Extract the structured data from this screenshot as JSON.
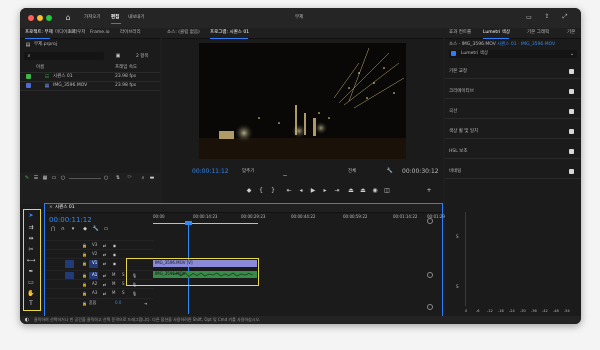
{
  "window": {
    "title": "무제"
  },
  "nav": {
    "home_label": "⌂",
    "import": "가져오기",
    "edit": "편집",
    "export": "내보내기"
  },
  "project_panel": {
    "tabs": [
      "프로젝트: 무제",
      "미디어 브라우저",
      "효과",
      "Frame.io",
      "라이브러리"
    ],
    "path": "무제.prproj",
    "item_count": "2 항목",
    "col_name": "이름",
    "col_fps": "프레임 속도",
    "items": [
      {
        "name": "시퀀스 01",
        "fps": "23.98 fps",
        "color": "#3fb649"
      },
      {
        "name": "IMG_3596.MOV",
        "fps": "23.98 fps",
        "color": "#4c6bd8"
      }
    ]
  },
  "source_monitor": {
    "tab_source": "소스: (클립 없음)",
    "tab_program": "프로그램: 시퀀스 01",
    "timecode_in": "00:00:11:12",
    "timecode_out": "00:00:30:12",
    "fit_label": "맞추기",
    "quality_label": "전체"
  },
  "timeline": {
    "tab": "시퀀스 01",
    "timecode": "00:00:11:12",
    "ruler": [
      "00:00",
      "00:00:14:23",
      "00:00:29:23",
      "00:00:44:22",
      "00:00:59:22",
      "00:01:14:22",
      "00:01:29:21"
    ],
    "video_tracks": [
      "V3",
      "V2",
      "V1"
    ],
    "audio_tracks": [
      "A1",
      "A2",
      "A3"
    ],
    "mix_label": "혼합",
    "mix_value": "0.0",
    "video_clip": "IMG_3596.MOV [V]",
    "audio_clip": "IMG_3596.MOV"
  },
  "bottom_toolbar": {
    "zoom_hint": "ㅁ·"
  },
  "lumetri": {
    "tabs": [
      "효과 컨트롤",
      "Lumetri 색상",
      "기본 그래픽",
      "기본"
    ],
    "target": "소스 · IMG_3596.MOV",
    "sequence_target": "시퀀스 01 · IMG_3596.MOV",
    "effect": "Lumetri 색상",
    "sections": [
      "기본 교정",
      "크리에이티브",
      "곡선",
      "색상 휠 및 일치",
      "HSL 보조",
      "비네팅"
    ]
  },
  "audio_meter": {
    "labels": [
      "0",
      "-6",
      "-12",
      "-18",
      "-24",
      "-30",
      "-36",
      "-42",
      "-48",
      "-54"
    ],
    "s_label": "S"
  },
  "status_bar": {
    "text": "클릭하여 선택하거나 빈 공간을 클릭하고 선택 윤곽으로 드래그합니다. 다른 옵션을 사용하려면 Shift, Opt 및 Cmd 키를 사용하십시오."
  },
  "colors": {
    "accent": "#2f7cf6",
    "video_clip": "#8a8ad8",
    "audio_clip": "#3a8a4a",
    "highlight": "#e6d84a"
  }
}
